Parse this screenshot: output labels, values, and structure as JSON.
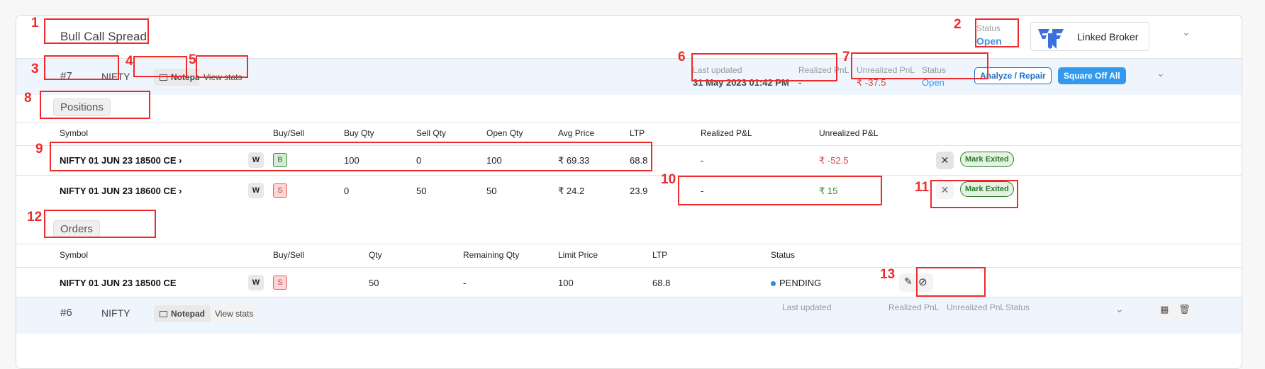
{
  "strategy": {
    "title": "Bull Call Spread",
    "status_label": "Status",
    "status_value": "Open",
    "broker_label": "Linked Broker",
    "brand_color": "#3b6fe0"
  },
  "strategy_bar": {
    "id": "#7",
    "symbol": "NIFTY",
    "notepad_label": "Notepad",
    "view_stats_label": "View stats",
    "last_updated_label": "Last updated",
    "last_updated_value": "31 May 2023 01:42 PM",
    "realized_label": "Realized PnL",
    "realized_value": "-",
    "unrealized_label": "Unrealized PnL",
    "unrealized_value": "₹ -37.5",
    "status_label": "Status",
    "status_value": "Open",
    "analyze_label": "Analyze / Repair",
    "square_off_label": "Square Off All"
  },
  "positions": {
    "tab_label": "Positions",
    "headers": [
      "Symbol",
      "Buy/Sell",
      "Buy Qty",
      "Sell Qty",
      "Open Qty",
      "Avg Price",
      "LTP",
      "Realized P&L",
      "Unrealized P&L"
    ],
    "rows": [
      {
        "symbol": "NIFTY 01 JUN 23 18500 CE",
        "w": "W",
        "side": "B",
        "buy_qty": "100",
        "sell_qty": "0",
        "open_qty": "100",
        "avg_price": "₹ 69.33",
        "ltp": "68.8",
        "realized": "-",
        "unrealized": "₹ -52.5",
        "exit_label": "Mark Exited"
      },
      {
        "symbol": "NIFTY 01 JUN 23 18600 CE",
        "w": "W",
        "side": "S",
        "buy_qty": "0",
        "sell_qty": "50",
        "open_qty": "50",
        "avg_price": "₹ 24.2",
        "ltp": "23.9",
        "realized": "-",
        "unrealized": "₹ 15",
        "exit_label": "Mark Exited"
      }
    ]
  },
  "orders": {
    "tab_label": "Orders",
    "headers": [
      "Symbol",
      "Buy/Sell",
      "Qty",
      "Remaining Qty",
      "Limit Price",
      "LTP",
      "Status"
    ],
    "rows": [
      {
        "symbol": "NIFTY 01 JUN 23 18500 CE",
        "w": "W",
        "side": "S",
        "qty": "50",
        "remaining": "-",
        "limit": "100",
        "ltp": "68.8",
        "status": "PENDING"
      }
    ]
  },
  "next_strategy_bar": {
    "id": "#6",
    "symbol": "NIFTY",
    "notepad_label": "Notepad",
    "view_stats_label": "View stats",
    "last_updated_label": "Last updated",
    "realized_label": "Realized PnL",
    "unrealized_label": "Unrealized PnL",
    "status_label": "Status"
  },
  "annotations": [
    "1",
    "2",
    "3",
    "4",
    "5",
    "6",
    "7",
    "8",
    "9",
    "10",
    "11",
    "12",
    "13"
  ]
}
